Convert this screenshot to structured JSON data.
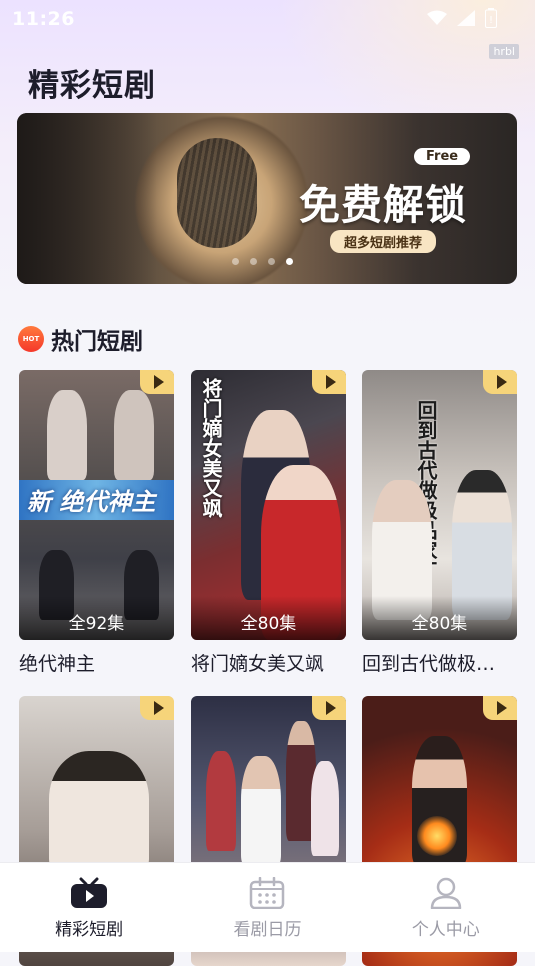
{
  "status_bar": {
    "time": "11:26",
    "watermark": "hrbl"
  },
  "app_title": "精彩短剧",
  "banner": {
    "badge": "Free",
    "headline": "免费解锁",
    "subtitle": "超多短剧推荐",
    "dots": 4,
    "active_dot": 3
  },
  "section": {
    "hot_badge": "HOT",
    "title": "热门短剧"
  },
  "dramas": [
    {
      "title": "绝代神主",
      "episodes": "全92集",
      "poster_text": "新 绝代神主"
    },
    {
      "title": "将门嫡女美又飒",
      "episodes": "全80集",
      "poster_text": "将门嫡女美又飒"
    },
    {
      "title": "回到古代做极…",
      "episodes": "全80集",
      "poster_text": "回到古代做极品家丁"
    },
    {
      "title": "",
      "episodes": "",
      "poster_text": ""
    },
    {
      "title": "",
      "episodes": "",
      "poster_text": ""
    },
    {
      "title": "",
      "episodes": "",
      "poster_text": ""
    }
  ],
  "tabbar": {
    "items": [
      {
        "label": "精彩短剧",
        "icon": "tv-icon",
        "active": true
      },
      {
        "label": "看剧日历",
        "icon": "calendar-icon",
        "active": false
      },
      {
        "label": "个人中心",
        "icon": "user-icon",
        "active": false
      }
    ]
  },
  "colors": {
    "accent_badge": "#f6d47a",
    "hot": "#f5382a",
    "text_primary": "#1d1d2b",
    "text_muted": "#9b9ba6"
  }
}
